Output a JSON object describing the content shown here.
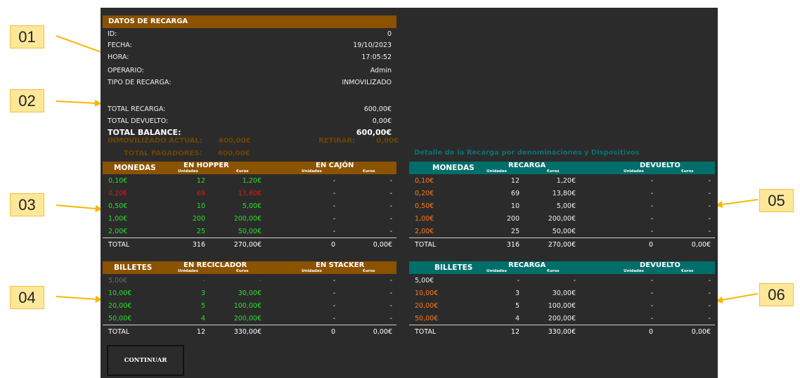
{
  "callouts": [
    "01",
    "02",
    "03",
    "04",
    "05",
    "06"
  ],
  "recarga": {
    "title": "DATOS DE RECARGA",
    "fields": [
      {
        "label": "ID:",
        "value": "0"
      },
      {
        "label": "FECHA:",
        "value": "19/10/2023"
      },
      {
        "label": "HORA:",
        "value": "17:05:52"
      },
      {
        "label": "OPERARIO:",
        "value": "Admin"
      },
      {
        "label": "TIPO DE RECARGA:",
        "value": "INMOVILIZADO"
      }
    ],
    "total_recarga": {
      "label": "TOTAL RECARGA:",
      "value": "600,00€"
    },
    "total_devuelto": {
      "label": "TOTAL DEVUELTO:",
      "value": "0,00€"
    },
    "total_balance": {
      "label": "TOTAL BALANCE:",
      "value": "600,00€"
    },
    "inmovilizado": {
      "label": "INMOVILIZADO ACTUAL:",
      "value": "600,00€"
    },
    "retirar": {
      "label": "RETIRAR:",
      "value": "0,00€"
    },
    "pagadores": {
      "label": "TOTAL PAGADORES:",
      "value": "600,00€"
    }
  },
  "detail_title": "Detalle de la Recarga por denominaciones y Dispositivos",
  "sub_units": "Unidades",
  "sub_euros": "€uros",
  "left_monedas": {
    "category": "MONEDAS",
    "group1": "EN HOPPER",
    "group2": "EN CAJÓN",
    "rows": [
      [
        "0,10€",
        "12",
        "1,20€",
        "-",
        "-"
      ],
      [
        "0,20€",
        "69",
        "13,80€",
        "-",
        "-"
      ],
      [
        "0,50€",
        "10",
        "5,00€",
        "-",
        "-"
      ],
      [
        "1,00€",
        "200",
        "200,00€",
        "-",
        "-"
      ],
      [
        "2,00€",
        "25",
        "50,00€",
        "-",
        "-"
      ]
    ],
    "total": [
      "TOTAL",
      "316",
      "270,00€",
      "0",
      "0,00€"
    ]
  },
  "left_billetes": {
    "category": "BILLETES",
    "group1": "EN RECICLADOR",
    "group2": "EN STACKER",
    "rows": [
      [
        "5,00€",
        "-",
        "-",
        "-",
        "-"
      ],
      [
        "10,00€",
        "3",
        "30,00€",
        "-",
        "-"
      ],
      [
        "20,00€",
        "5",
        "100,00€",
        "-",
        "-"
      ],
      [
        "50,00€",
        "4",
        "200,00€",
        "-",
        "-"
      ]
    ],
    "total": [
      "TOTAL",
      "12",
      "330,00€",
      "0",
      "0,00€"
    ]
  },
  "right_monedas": {
    "category": "MONEDAS",
    "group1": "RECARGA",
    "group2": "DEVUELTO",
    "rows": [
      [
        "0,10€",
        "12",
        "1,20€",
        "-",
        "-"
      ],
      [
        "0,20€",
        "69",
        "13,80€",
        "-",
        "-"
      ],
      [
        "0,50€",
        "10",
        "5,00€",
        "-",
        "-"
      ],
      [
        "1,00€",
        "200",
        "200,00€",
        "-",
        "-"
      ],
      [
        "2,00€",
        "25",
        "50,00€",
        "-",
        "-"
      ]
    ],
    "total": [
      "TOTAL",
      "316",
      "270,00€",
      "0",
      "0,00€"
    ]
  },
  "right_billetes": {
    "category": "BILLETES",
    "group1": "RECARGA",
    "group2": "DEVUELTO",
    "rows": [
      [
        "5,00€",
        "-",
        "-",
        "-",
        "-"
      ],
      [
        "10,00€",
        "3",
        "30,00€",
        "-",
        "-"
      ],
      [
        "20,00€",
        "5",
        "100,00€",
        "-",
        "-"
      ],
      [
        "50,00€",
        "4",
        "200,00€",
        "-",
        "-"
      ]
    ],
    "total": [
      "TOTAL",
      "12",
      "330,00€",
      "0",
      "0,00€"
    ]
  },
  "continue_label": "CONTINUAR"
}
